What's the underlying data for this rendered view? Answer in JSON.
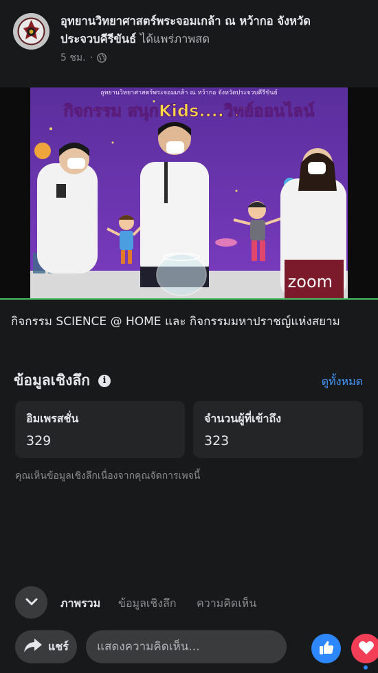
{
  "post": {
    "author": "อุทยานวิทยาศาสตร์พระจอมเกล้า ณ หว้ากอ จังหวัดประจวบคีรีขันธ์",
    "action": "ได้แพร่ภาพสด",
    "time": "5 ชม.",
    "separator": "·",
    "privacy_icon": "globe-icon"
  },
  "video": {
    "header_small": "อุทยานวิทยาศาสตร์พระจอมเกล้า ณ หว้ากอ จังหวัดประจวบคีรีขันธ์",
    "header_title": "กิจกรรม สนุกKids....วิทย์ออนไลน์",
    "watermark": "zoom"
  },
  "caption": "กิจกรรม SCIENCE @ HOME และ กิจกรรมมหาปราชญ์แห่งสยาม",
  "insights": {
    "title": "ข้อมูลเชิงลึก",
    "see_all": "ดูทั้งหมด",
    "impressions_label": "อิมเพรสชั่น",
    "impressions_value": "329",
    "reach_label": "จำนวนผู้ที่เข้าถึง",
    "reach_value": "323",
    "note": "คุณเห็นข้อมูลเชิงลึกเนื่องจากคุณจัดการเพจนี้"
  },
  "tabs": [
    {
      "label": "ภาพรวม"
    },
    {
      "label": "ข้อมูลเชิงลึก"
    },
    {
      "label": "ความคิดเห็น"
    }
  ],
  "actions": {
    "share_label": "แชร์",
    "comment_placeholder": "แสดงความคิดเห็น..."
  },
  "colors": {
    "background": "#18191a",
    "card": "#242526",
    "link": "#4599ff",
    "like": "#2d88ff",
    "love": "#f33e58",
    "live_progress": "#45bd62"
  }
}
